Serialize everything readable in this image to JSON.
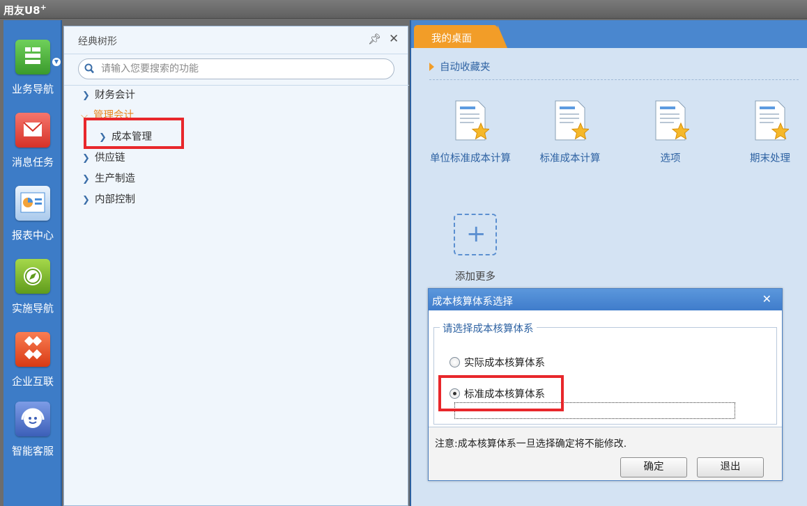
{
  "app": {
    "brand": "用友U8",
    "brand_sup": "+"
  },
  "leftbar": {
    "items": [
      {
        "label": "业务导航",
        "icon": "business-nav-icon",
        "color": "#4db33c"
      },
      {
        "label": "消息任务",
        "icon": "message-task-icon",
        "color": "#e9453a"
      },
      {
        "label": "报表中心",
        "icon": "report-center-icon",
        "color": "#4a8fd9"
      },
      {
        "label": "实施导航",
        "icon": "compass-icon",
        "color": "#7ab82a"
      },
      {
        "label": "企业互联",
        "icon": "enterprise-connect-icon",
        "color": "#ee4f2a"
      },
      {
        "label": "智能客服",
        "icon": "headset-icon",
        "color": "#4a6fc2"
      }
    ]
  },
  "tree": {
    "title": "经典树形",
    "search_placeholder": "请输入您要搜索的功能",
    "items": [
      {
        "label": "财务会计"
      },
      {
        "label": "管理会计"
      },
      {
        "label": "成本管理"
      },
      {
        "label": "供应链"
      },
      {
        "label": "生产制造"
      },
      {
        "label": "内部控制"
      }
    ]
  },
  "desk": {
    "tab": "我的桌面",
    "favorites": "自动收藏夹",
    "apps": [
      {
        "label": "单位标准成本计算"
      },
      {
        "label": "标准成本计算"
      },
      {
        "label": "选项"
      },
      {
        "label": "期末处理"
      }
    ],
    "add_more": "添加更多"
  },
  "dialog": {
    "title": "成本核算体系选择",
    "group": "请选择成本核算体系",
    "option_actual": "实际成本核算体系",
    "option_standard": "标准成本核算体系",
    "note": "注意:成本核算体系一旦选择确定将不能修改.",
    "ok": "确定",
    "exit": "退出"
  },
  "colors": {
    "accent_blue": "#3d7cc7",
    "tab_orange": "#f29d28",
    "highlight_red": "#e8272b"
  }
}
